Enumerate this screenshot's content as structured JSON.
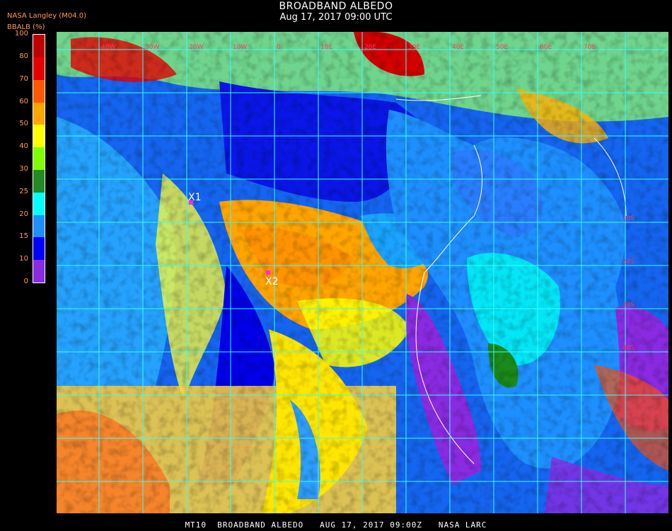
{
  "header": {
    "title": "BROADBAND ALBEDO",
    "subtitle": "Aug 17, 2017 09:00 UTC",
    "source": "NASA Langley  (M04.0)",
    "unit_label": "BBALB (%)"
  },
  "legend": {
    "ticks": [
      "100",
      "80",
      "70",
      "60",
      "50",
      "40",
      "30",
      "25",
      "20",
      "15",
      "10",
      "0"
    ],
    "colors": [
      "#c00000",
      "#e60000",
      "#ff5a00",
      "#ffa500",
      "#ffff00",
      "#7fff00",
      "#228b22",
      "#00ffff",
      "#1e90ff",
      "#0000ff",
      "#8a2be2"
    ]
  },
  "map": {
    "markers": [
      {
        "label": "X1"
      },
      {
        "label": "X2"
      }
    ],
    "lon_labels": [
      "40W",
      "30W",
      "20W",
      "10W",
      "0",
      "10E",
      "20E",
      "30E",
      "40E",
      "50E",
      "60E",
      "70E"
    ],
    "lat_labels": [
      "10S",
      "20S",
      "30S",
      "40S"
    ]
  },
  "footer": {
    "text": "MT10  BROADBAND ALBEDO   AUG 17, 2017 09:00Z   NASA LARC"
  }
}
